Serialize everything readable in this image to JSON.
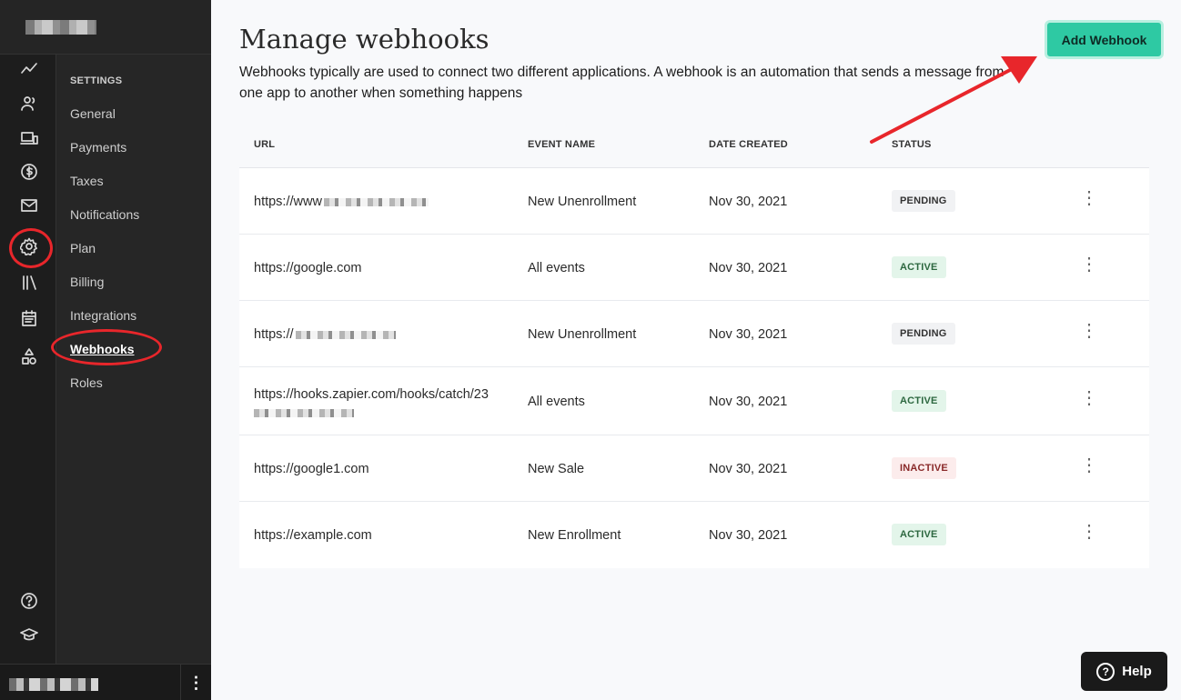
{
  "settings": {
    "heading": "SETTINGS",
    "items": [
      "General",
      "Payments",
      "Taxes",
      "Notifications",
      "Plan",
      "Billing",
      "Integrations",
      "Webhooks",
      "Roles"
    ],
    "active": "Webhooks"
  },
  "rail_icons": [
    "analytics-icon",
    "users-icon",
    "products-icon",
    "dollar-icon",
    "mail-icon",
    "settings-gear-icon",
    "library-icon",
    "calendar-icon",
    "shapes-icon",
    "help-circle-icon",
    "graduation-cap-icon"
  ],
  "main": {
    "title": "Manage webhooks",
    "description": "Webhooks typically are used to connect two different applications. A webhook is an automation that sends a message from one app to another when something happens",
    "add_button": "Add Webhook"
  },
  "table": {
    "headers": [
      "URL",
      "EVENT NAME",
      "DATE CREATED",
      "STATUS"
    ],
    "rows": [
      {
        "url": "https://www",
        "event": "New Unenrollment",
        "date": "Nov 30, 2021",
        "status": "PENDING"
      },
      {
        "url": "https://google.com",
        "event": "All events",
        "date": "Nov 30, 2021",
        "status": "ACTIVE"
      },
      {
        "url": "https://",
        "event": "New Unenrollment",
        "date": "Nov 30, 2021",
        "status": "PENDING"
      },
      {
        "url": "https://hooks.zapier.com/hooks/catch/23",
        "event": "All events",
        "date": "Nov 30, 2021",
        "status": "ACTIVE"
      },
      {
        "url": "https://google1.com",
        "event": "New Sale",
        "date": "Nov 30, 2021",
        "status": "INACTIVE"
      },
      {
        "url": "https://example.com",
        "event": "New Enrollment",
        "date": "Nov 30, 2021",
        "status": "ACTIVE"
      }
    ]
  },
  "help_button": "Help",
  "colors": {
    "accent": "#2ec9a3",
    "annotation": "#e8262b",
    "sidebar_bg": "#1f1f1f"
  }
}
